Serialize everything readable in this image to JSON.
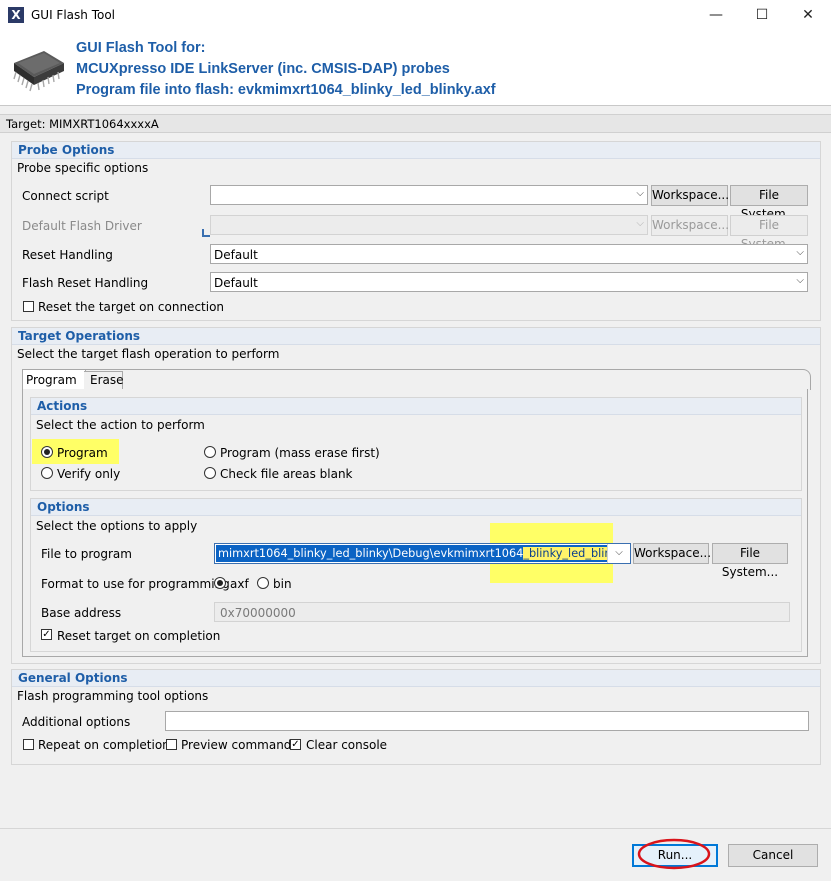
{
  "window": {
    "title": "GUI Flash Tool",
    "app_icon": "X",
    "minimize_icon": "—",
    "maximize_icon": "☐",
    "close_icon": "✕"
  },
  "header": {
    "line1": "GUI Flash Tool for:",
    "line2": "MCUXpresso IDE LinkServer (inc. CMSIS-DAP) probes",
    "line3": "Program file into flash: evkmimxrt1064_blinky_led_blinky.axf",
    "chip_icon": "chip-icon"
  },
  "target": "Target: MIMXRT1064xxxxA",
  "probe_options": {
    "title": "Probe Options",
    "subtitle": "Probe specific options",
    "connect_script_label": "Connect script",
    "connect_script_value": "",
    "default_flash_driver_label": "Default Flash Driver",
    "default_flash_driver_value": "",
    "reset_handling_label": "Reset Handling",
    "reset_handling_value": "Default",
    "flash_reset_handling_label": "Flash Reset Handling",
    "flash_reset_handling_value": "Default",
    "reset_on_connection_label": "Reset the target on connection",
    "reset_on_connection_checked": false,
    "workspace_label": "Workspace...",
    "filesystem_label": "File System..."
  },
  "target_operations": {
    "title": "Target Operations",
    "subtitle": "Select the target flash operation to perform",
    "tabs": [
      {
        "label": "Program",
        "active": true
      },
      {
        "label": "Erase",
        "active": false
      }
    ],
    "actions": {
      "title": "Actions",
      "subtitle": "Select the action to perform",
      "program_label": "Program",
      "program_mass_erase_label": "Program (mass erase first)",
      "verify_only_label": "Verify only",
      "check_blank_label": "Check file areas blank",
      "selected": "Program"
    },
    "options": {
      "title": "Options",
      "subtitle": "Select the options to apply",
      "file_to_program_label": "File to program",
      "file_to_program_value_pre": "mimxrt1064_blinky_led_blinky\\Debug\\evkmimxrt1064",
      "file_to_program_value_hl": "_blinky_led_blinky.axf",
      "format_label": "Format to use for programming",
      "format_axf": "axf",
      "format_bin": "bin",
      "format_selected": "axf",
      "base_address_label": "Base address",
      "base_address_value": "0x70000000",
      "reset_on_completion_label": "Reset target on completion",
      "reset_on_completion_checked": true,
      "workspace_label": "Workspace...",
      "filesystem_label": "File System..."
    }
  },
  "general_options": {
    "title": "General Options",
    "subtitle": "Flash programming tool options",
    "additional_options_label": "Additional options",
    "additional_options_value": "",
    "repeat_label": "Repeat on completion",
    "repeat_checked": false,
    "preview_label": "Preview command",
    "preview_checked": false,
    "clear_console_label": "Clear console",
    "clear_console_checked": true
  },
  "footer": {
    "run_label": "Run...",
    "cancel_label": "Cancel"
  },
  "colors": {
    "accent": "#1e5ea8",
    "highlight": "#ffff66",
    "annotation": "#d9141b"
  },
  "glyphs": {
    "check": "✓",
    "dropdown": "⌵"
  }
}
